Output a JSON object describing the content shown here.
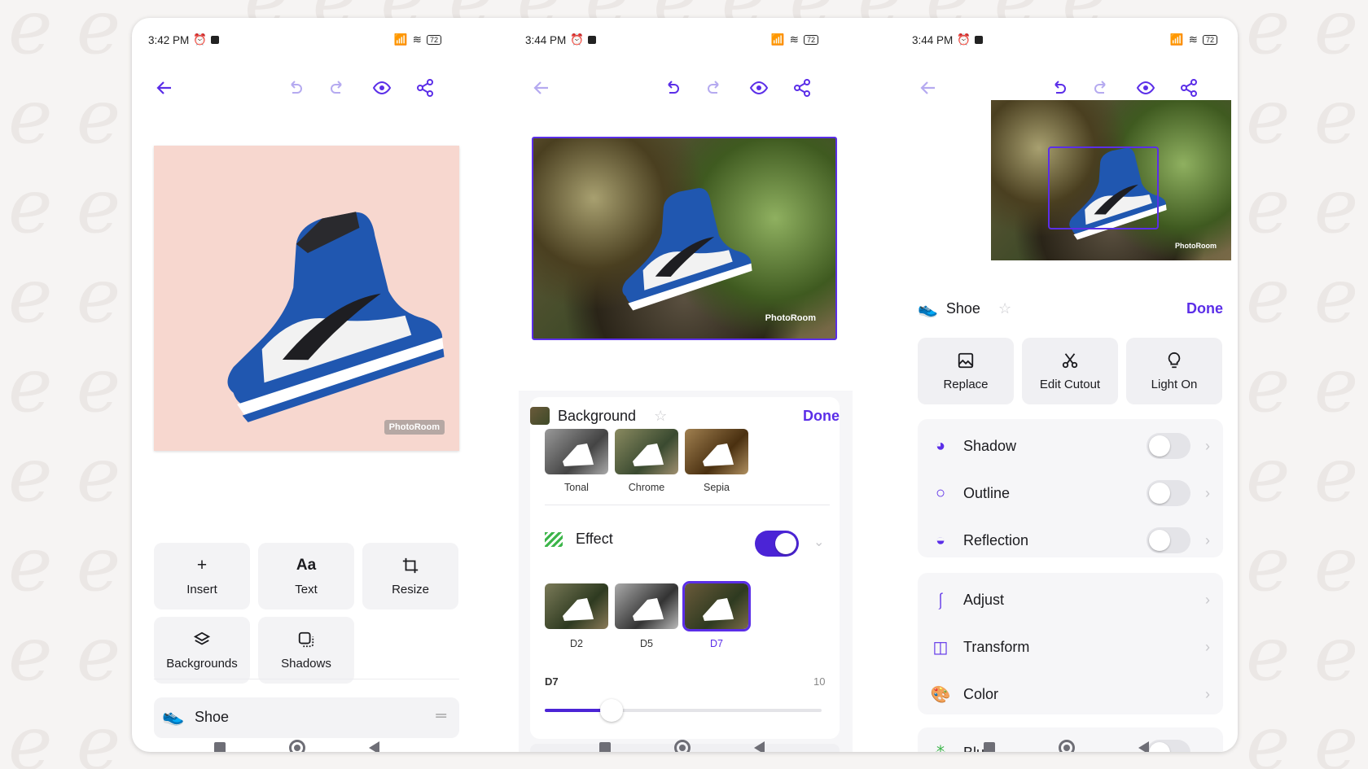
{
  "phone1": {
    "status_time": "3:42 PM",
    "battery": "72",
    "watermark": "PhotoRoom",
    "tools": [
      {
        "label": "Insert",
        "icon": "+"
      },
      {
        "label": "Text",
        "icon": "Aa"
      },
      {
        "label": "Resize",
        "icon": "crop"
      },
      {
        "label": "Backgrounds",
        "icon": "layers"
      },
      {
        "label": "Shadows",
        "icon": "shadow"
      }
    ],
    "layer_label": "Shoe"
  },
  "phone2": {
    "status_time": "3:44 PM",
    "battery": "72",
    "watermark": "PhotoRoom",
    "panel_title": "Background",
    "done_label": "Done",
    "filters": [
      "Tonal",
      "Chrome",
      "Sepia"
    ],
    "effect_label": "Effect",
    "effect_on": true,
    "effect_options": [
      "D2",
      "D5",
      "D7"
    ],
    "effect_selected": "D7",
    "slider_label": "D7",
    "slider_max": "10",
    "slider_value": 0.24
  },
  "phone3": {
    "status_time": "3:44 PM",
    "battery": "72",
    "watermark": "PhotoRoom",
    "panel_title": "Shoe",
    "done_label": "Done",
    "actions": [
      "Replace",
      "Edit Cutout",
      "Light On"
    ],
    "toggles": [
      {
        "label": "Shadow",
        "on": false
      },
      {
        "label": "Outline",
        "on": false
      },
      {
        "label": "Reflection",
        "on": false
      }
    ],
    "menu": [
      "Adjust",
      "Transform",
      "Color"
    ],
    "blur_label": "Blur"
  },
  "colors": {
    "accent": "#5b2ee8",
    "toggle_on": "#4b24d6",
    "canvas_pink": "#f7d7cf"
  }
}
